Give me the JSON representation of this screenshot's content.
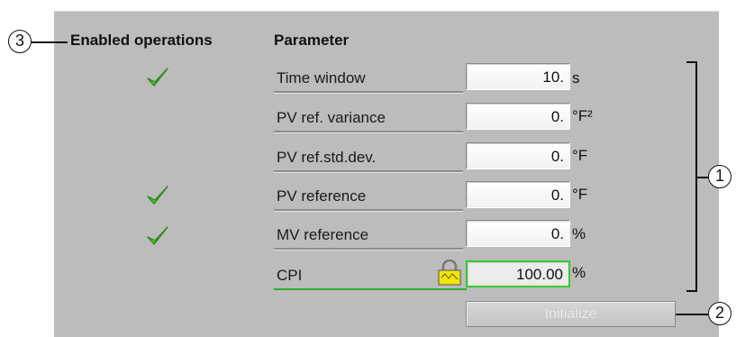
{
  "headers": {
    "enabled_operations": "Enabled operations",
    "parameter": "Parameter"
  },
  "rows": [
    {
      "label": "Time window",
      "value": "10.",
      "unit": "s",
      "enabled_check": true
    },
    {
      "label": "PV ref. variance",
      "value": "0.",
      "unit": "°F²",
      "enabled_check": false
    },
    {
      "label": "PV ref.std.dev.",
      "value": "0.",
      "unit": "°F",
      "enabled_check": false
    },
    {
      "label": "PV reference",
      "value": "0.",
      "unit": "°F",
      "enabled_check": true
    },
    {
      "label": "MV reference",
      "value": "0.",
      "unit": "%",
      "enabled_check": true
    },
    {
      "label": "CPI",
      "value": "100.00",
      "unit": "%",
      "enabled_check": false
    }
  ],
  "initialize_label": "Initialize",
  "callouts": {
    "one": "1",
    "two": "2",
    "three": "3"
  },
  "icons": {
    "check": "check-icon",
    "lock": "lock-icon"
  },
  "colors": {
    "panel": "#bcbcbc",
    "check": "#33aa22",
    "cpi_highlight": "#33cc33",
    "lock_yellow": "#f2e600"
  }
}
